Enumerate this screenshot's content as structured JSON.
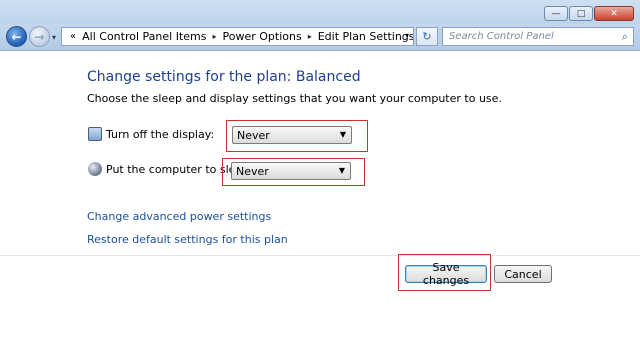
{
  "window": {
    "minimize_glyph": "—",
    "maximize_glyph": "□",
    "close_glyph": "✕"
  },
  "navigation": {
    "back_glyph": "←",
    "forward_glyph": "→",
    "recent_glyph": "▾",
    "address_lead": "«",
    "breadcrumbs": [
      "All Control Panel Items",
      "Power Options",
      "Edit Plan Settings"
    ],
    "breadcrumb_sep": "▸",
    "address_dropdown_glyph": "▾",
    "refresh_glyph": "↻",
    "search_placeholder": "Search Control Panel",
    "search_glyph": "⌕"
  },
  "main": {
    "heading": "Change settings for the plan: Balanced",
    "description": "Choose the sleep and display settings that you want your computer to use.",
    "settings": [
      {
        "label": "Turn off the display:",
        "value": "Never",
        "icon": "display-icon"
      },
      {
        "label": "Put the computer to sleep:",
        "value": "Never",
        "icon": "moon-icon"
      }
    ],
    "links": {
      "advanced": "Change advanced power settings",
      "restore": "Restore default settings for this plan"
    }
  },
  "buttons": {
    "save": "Save changes",
    "cancel": "Cancel"
  },
  "colors": {
    "highlight": "#c8352b",
    "link": "#1c4fa0",
    "heading": "#1e3f8c"
  }
}
